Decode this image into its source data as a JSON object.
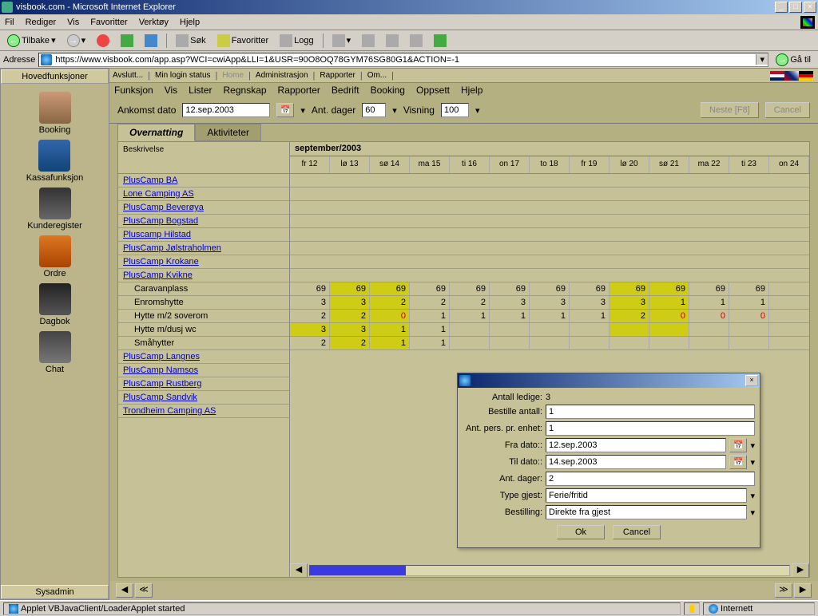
{
  "window": {
    "title": "visbook.com - Microsoft Internet Explorer"
  },
  "ie_menu": [
    "Fil",
    "Rediger",
    "Vis",
    "Favoritter",
    "Verktøy",
    "Hjelp"
  ],
  "ie_toolbar": {
    "back": "Tilbake",
    "search": "Søk",
    "favorites": "Favoritter",
    "logg": "Logg"
  },
  "address": {
    "label": "Adresse",
    "url": "https://www.visbook.com/app.asp?WCI=cwiApp&LLI=1&USR=90O8OQ78GYM76SG80G1&ACTION=-1",
    "go": "Gå til"
  },
  "applet_topbar": {
    "avslutt": "Avslutt...",
    "login": "Min login status",
    "home": "Home",
    "admin": "Administrasjon",
    "rapporter": "Rapporter",
    "om": "Om..."
  },
  "applet_menu": [
    "Funksjon",
    "Vis",
    "Lister",
    "Regnskap",
    "Rapporter",
    "Bedrift",
    "Booking",
    "Oppsett",
    "Hjelp"
  ],
  "sidebar": {
    "title": "Hovedfunksjoner",
    "items": [
      {
        "label": "Booking"
      },
      {
        "label": "Kassafunksjon"
      },
      {
        "label": "Kunderegister"
      },
      {
        "label": "Ordre"
      },
      {
        "label": "Dagbok"
      },
      {
        "label": "Chat"
      }
    ],
    "sysadmin": "Sysadmin"
  },
  "filter": {
    "ankomst_label": "Ankomst dato",
    "ankomst_value": "12.sep.2003",
    "dager_label": "Ant. dager",
    "dager_value": "60",
    "visning_label": "Visning",
    "visning_value": "100",
    "neste": "Neste [F8]",
    "cancel": "Cancel"
  },
  "tabs": {
    "overnatting": "Overnatting",
    "aktiviteter": "Aktiviteter"
  },
  "tree": {
    "head": "Beskrivelse",
    "rows": [
      {
        "label": "PlusCamp BA",
        "child": false
      },
      {
        "label": "Lone Camping AS",
        "child": false
      },
      {
        "label": "PlusCamp Beverøya",
        "child": false
      },
      {
        "label": "PlusCamp Bogstad",
        "child": false
      },
      {
        "label": "Pluscamp Hilstad",
        "child": false
      },
      {
        "label": "PlusCamp Jølstraholmen",
        "child": false
      },
      {
        "label": "PlusCamp Krokane",
        "child": false
      },
      {
        "label": "PlusCamp Kvikne",
        "child": false
      },
      {
        "label": "Caravanplass",
        "child": true
      },
      {
        "label": "Enromshytte",
        "child": true
      },
      {
        "label": "Hytte m/2 soverom",
        "child": true
      },
      {
        "label": "Hytte m/dusj wc",
        "child": true
      },
      {
        "label": "Småhytter",
        "child": true
      },
      {
        "label": "PlusCamp Langnes",
        "child": false
      },
      {
        "label": "PlusCamp Namsos",
        "child": false
      },
      {
        "label": "PlusCamp Rustberg",
        "child": false
      },
      {
        "label": "PlusCamp Sandvik",
        "child": false
      },
      {
        "label": "Trondheim Camping AS",
        "child": false
      }
    ]
  },
  "calendar": {
    "title": "september/2003",
    "days": [
      "fr 12",
      "lø 13",
      "sø 14",
      "ma 15",
      "ti 16",
      "on 17",
      "to 18",
      "fr 19",
      "lø 20",
      "sø 21",
      "ma 22",
      "ti 23",
      "on 24"
    ]
  },
  "chart_data": {
    "type": "table",
    "columns": [
      "fr 12",
      "lø 13",
      "sø 14",
      "ma 15",
      "ti 16",
      "on 17",
      "to 18",
      "fr 19",
      "lø 20",
      "sø 21",
      "ma 22",
      "ti 23"
    ],
    "rows": [
      {
        "name": "Caravanplass",
        "values": [
          69,
          69,
          69,
          69,
          69,
          69,
          69,
          69,
          69,
          69,
          69,
          69
        ],
        "hilite": [
          1,
          2,
          8,
          9
        ]
      },
      {
        "name": "Enromshytte",
        "values": [
          3,
          3,
          2,
          2,
          2,
          3,
          3,
          3,
          3,
          1,
          1,
          1
        ],
        "hilite": [
          1,
          2,
          8,
          9
        ]
      },
      {
        "name": "Hytte m/2 soverom",
        "values": [
          2,
          2,
          0,
          1,
          1,
          1,
          1,
          1,
          2,
          0,
          0,
          0
        ],
        "hilite": [
          1,
          2,
          8,
          9
        ],
        "red": [
          2,
          9,
          10,
          11
        ]
      },
      {
        "name": "Hytte m/dusj wc",
        "values": [
          3,
          3,
          1,
          1,
          "",
          "",
          "",
          "",
          "",
          "",
          "",
          ""
        ],
        "hilite": [
          0,
          1,
          2,
          8,
          9
        ],
        "boxed": true
      },
      {
        "name": "Småhytter",
        "values": [
          2,
          2,
          1,
          1,
          "",
          "",
          "",
          "",
          "",
          "",
          "",
          ""
        ],
        "hilite": [
          1,
          2
        ]
      }
    ]
  },
  "dialog": {
    "antall_ledige_label": "Antall ledige:",
    "antall_ledige": "3",
    "bestille_label": "Bestille antall:",
    "bestille": "1",
    "pers_label": "Ant. pers. pr. enhet:",
    "pers": "1",
    "fra_label": "Fra dato::",
    "fra": "12.sep.2003",
    "til_label": "Til dato::",
    "til": "14.sep.2003",
    "dager_label": "Ant. dager:",
    "dager": "2",
    "type_label": "Type gjest:",
    "type": "Ferie/fritid",
    "bestilling_label": "Bestilling:",
    "bestilling": "Direkte fra gjest",
    "ok": "Ok",
    "cancel": "Cancel"
  },
  "status": {
    "applet": "Applet VBJavaClient/LoaderApplet started",
    "zone": "Internett"
  }
}
